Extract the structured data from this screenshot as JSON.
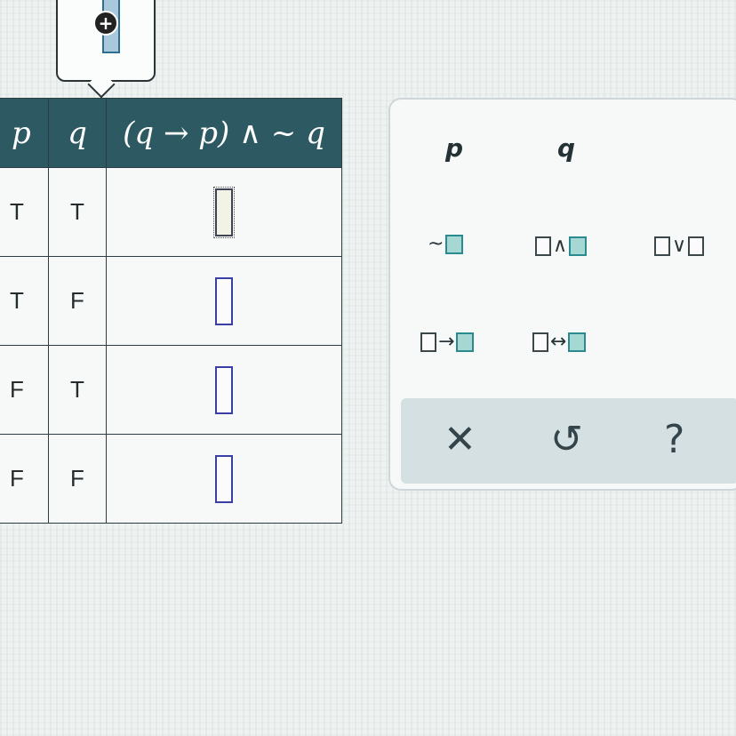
{
  "tooltip": {
    "plus_icon": "+"
  },
  "table": {
    "headers": {
      "p": "p",
      "q": "q",
      "expr": "(q → p) ∧ ~ q"
    },
    "rows": [
      {
        "p": "T",
        "q": "T"
      },
      {
        "p": "T",
        "q": "F"
      },
      {
        "p": "F",
        "q": "T"
      },
      {
        "p": "F",
        "q": "F"
      }
    ]
  },
  "palette": {
    "vars": {
      "p": "p",
      "q": "q"
    },
    "ops": {
      "not": "~",
      "and": "∧",
      "or": "∨",
      "cond": "→",
      "bicond": "↔"
    },
    "actions": {
      "clear": "✕",
      "undo": "↺",
      "help": "?"
    }
  },
  "colors": {
    "header": "#2d5a62",
    "slot_border": "#3a3fa6",
    "palette_fill": "#a5d7d3"
  }
}
